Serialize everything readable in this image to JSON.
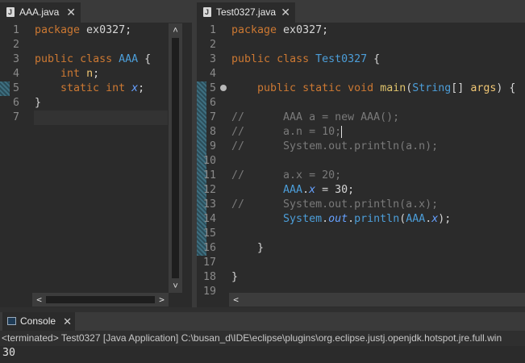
{
  "left_editor": {
    "tab_label": "AAA.java",
    "close_glyph": "✕",
    "lines": [
      {
        "num": "1",
        "t": [
          [
            "kw",
            "package"
          ],
          [
            "code",
            " ex0327;"
          ]
        ]
      },
      {
        "num": "2",
        "t": []
      },
      {
        "num": "3",
        "t": [
          [
            "kw",
            "public"
          ],
          [
            "code",
            " "
          ],
          [
            "kw",
            "class"
          ],
          [
            "code",
            " "
          ],
          [
            "cls",
            "AAA"
          ],
          [
            "code",
            " {"
          ]
        ]
      },
      {
        "num": "4",
        "t": [
          [
            "code",
            "    "
          ],
          [
            "kw",
            "int"
          ],
          [
            "code",
            " "
          ],
          [
            "var",
            "n"
          ],
          [
            "code",
            ";"
          ]
        ]
      },
      {
        "num": "5",
        "t": [
          [
            "code",
            "    "
          ],
          [
            "kw",
            "static"
          ],
          [
            "code",
            " "
          ],
          [
            "kw",
            "int"
          ],
          [
            "code",
            " "
          ],
          [
            "fld",
            "x"
          ],
          [
            "code",
            ";"
          ]
        ]
      },
      {
        "num": "6",
        "t": [
          [
            "code",
            "}"
          ]
        ]
      },
      {
        "num": "7",
        "t": []
      }
    ]
  },
  "right_editor": {
    "tab_label": "Test0327.java",
    "close_glyph": "✕",
    "lines": [
      {
        "num": "1",
        "t": [
          [
            "kw",
            "package"
          ],
          [
            "code",
            " ex0327;"
          ]
        ]
      },
      {
        "num": "2",
        "t": []
      },
      {
        "num": "3",
        "t": [
          [
            "kw",
            "public"
          ],
          [
            "code",
            " "
          ],
          [
            "kw",
            "class"
          ],
          [
            "code",
            " "
          ],
          [
            "cls",
            "Test0327"
          ],
          [
            "code",
            " {"
          ]
        ]
      },
      {
        "num": "4",
        "t": []
      },
      {
        "num": "5",
        "t": [
          [
            "code",
            "    "
          ],
          [
            "kw",
            "public"
          ],
          [
            "code",
            " "
          ],
          [
            "kw",
            "static"
          ],
          [
            "code",
            " "
          ],
          [
            "kw",
            "void"
          ],
          [
            "code",
            " "
          ],
          [
            "meth",
            "main"
          ],
          [
            "code",
            "("
          ],
          [
            "cls",
            "String"
          ],
          [
            "code",
            "[] "
          ],
          [
            "var",
            "args"
          ],
          [
            "code",
            ") {"
          ]
        ]
      },
      {
        "num": "6",
        "t": []
      },
      {
        "num": "7",
        "t": [
          [
            "cmt",
            "//      AAA a = new AAA();"
          ]
        ]
      },
      {
        "num": "8",
        "t": [
          [
            "cmt",
            "//      a.n = 10;"
          ]
        ],
        "caret": true
      },
      {
        "num": "9",
        "t": [
          [
            "cmt",
            "//      System.out.println(a.n);"
          ]
        ]
      },
      {
        "num": "10",
        "t": []
      },
      {
        "num": "11",
        "t": [
          [
            "cmt",
            "//      a.x = 20;"
          ]
        ]
      },
      {
        "num": "12",
        "t": [
          [
            "code",
            "        "
          ],
          [
            "cls",
            "AAA"
          ],
          [
            "code",
            "."
          ],
          [
            "fld",
            "x"
          ],
          [
            "code",
            " = 30;"
          ]
        ]
      },
      {
        "num": "13",
        "t": [
          [
            "cmt",
            "//      System.out.println(a.x);"
          ]
        ]
      },
      {
        "num": "14",
        "t": [
          [
            "code",
            "        "
          ],
          [
            "cls",
            "System"
          ],
          [
            "code",
            "."
          ],
          [
            "fld",
            "out"
          ],
          [
            "code",
            "."
          ],
          [
            "cls",
            "println"
          ],
          [
            "code",
            "("
          ],
          [
            "cls",
            "AAA"
          ],
          [
            "code",
            "."
          ],
          [
            "fld",
            "x"
          ],
          [
            "code",
            ");"
          ]
        ]
      },
      {
        "num": "15",
        "t": []
      },
      {
        "num": "16",
        "t": [
          [
            "code",
            "    }"
          ]
        ]
      },
      {
        "num": "17",
        "t": []
      },
      {
        "num": "18",
        "t": [
          [
            "code",
            "}"
          ]
        ]
      },
      {
        "num": "19",
        "t": []
      }
    ]
  },
  "scroll": {
    "up": "˄",
    "down": "˅",
    "left": "<",
    "right": ">"
  },
  "console": {
    "tab_label": "Console",
    "close_glyph": "✕",
    "status": "<terminated> Test0327 [Java Application] C:\\busan_d\\IDE\\eclipse\\plugins\\org.eclipse.justj.openjdk.hotspot.jre.full.win",
    "output": "30"
  }
}
